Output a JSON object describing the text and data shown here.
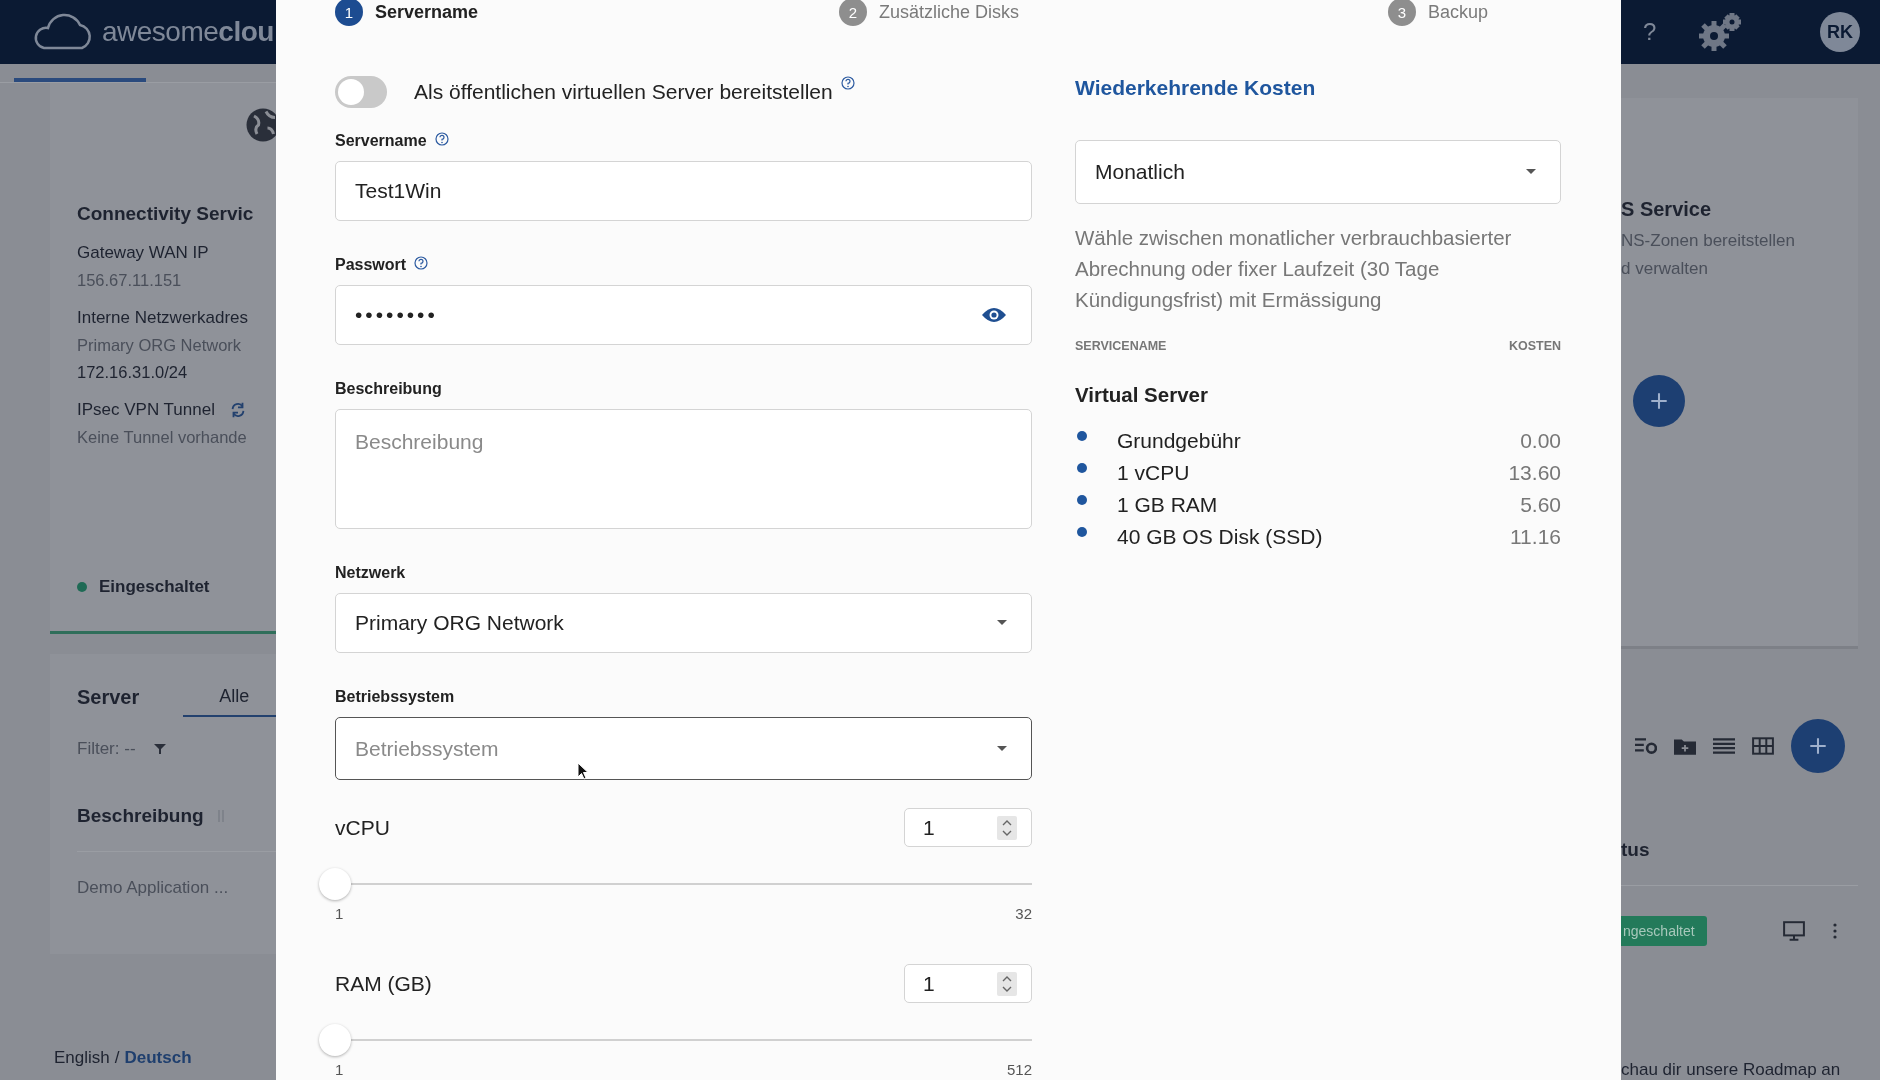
{
  "header": {
    "logo_light": "awesome",
    "logo_bold": "clou",
    "help": "?",
    "avatar": "RK"
  },
  "background_left": {
    "card_title": "Connectivity Servic",
    "fields": [
      {
        "label": "Gateway WAN IP",
        "values": [
          "156.67.11.151"
        ]
      },
      {
        "label": "Interne Netzwerkadres",
        "values": [
          "Primary ORG Network",
          "172.16.31.0/24"
        ]
      },
      {
        "label": "IPsec VPN Tunnel",
        "values": [
          "Keine Tunnel vorhande"
        ]
      }
    ],
    "status": "Eingeschaltet",
    "server_title": "Server",
    "tabs": [
      {
        "label": "Alle",
        "selected": true
      }
    ],
    "filter": "Filter: --",
    "column": "Beschreibung",
    "row": "Demo Application ...",
    "language": {
      "options": [
        {
          "label": "English",
          "selected": false
        },
        {
          "label": "Deutsch",
          "selected": true
        }
      ],
      "separator": "/"
    }
  },
  "background_right": {
    "card_title": "S Service",
    "card_text": [
      "NS-Zonen bereitstellen",
      "d verwalten"
    ],
    "column": "tus",
    "badge": "ngeschaltet",
    "footer": "chau dir unsere Roadmap an"
  },
  "dialog": {
    "steps": [
      {
        "number": "1",
        "label": "Servername",
        "selected": true
      },
      {
        "number": "2",
        "label": "Zusätzliche Disks",
        "selected": false
      },
      {
        "number": "3",
        "label": "Backup",
        "selected": false
      }
    ],
    "public_toggle": {
      "label": "Als öffentlichen virtuellen Server bereitstellen",
      "on": false
    },
    "servername": {
      "label": "Servername",
      "value": "Test1Win"
    },
    "password": {
      "label": "Passwort",
      "value": "••••••••"
    },
    "description": {
      "label": "Beschreibung",
      "placeholder": "Beschreibung"
    },
    "network": {
      "label": "Netzwerk",
      "value": "Primary ORG Network"
    },
    "os": {
      "label": "Betriebssystem",
      "placeholder": "Betriebssystem"
    },
    "sliders": [
      {
        "label": "vCPU",
        "value": "1",
        "level": 0,
        "min": "1",
        "max": "32"
      },
      {
        "label": "RAM (GB)",
        "value": "1",
        "level": 0,
        "min": "1",
        "max": "512"
      }
    ],
    "costs": {
      "title": "Wiederkehrende Kosten",
      "period": "Monatlich",
      "info": "Wähle zwischen monatlicher verbrauchbasierter Abrechnung oder fixer Laufzeit (30 Tage Kündigungsfrist) mit Ermässigung",
      "columns": [
        "SERVICENAME",
        "KOSTEN"
      ],
      "group": "Virtual Server",
      "items": [
        {
          "name": "Grundgebühr",
          "cost": "0.00"
        },
        {
          "name": "1 vCPU",
          "cost": "13.60"
        },
        {
          "name": "1 GB RAM",
          "cost": "5.60"
        },
        {
          "name": "40 GB OS Disk (SSD)",
          "cost": "11.16"
        }
      ]
    }
  }
}
